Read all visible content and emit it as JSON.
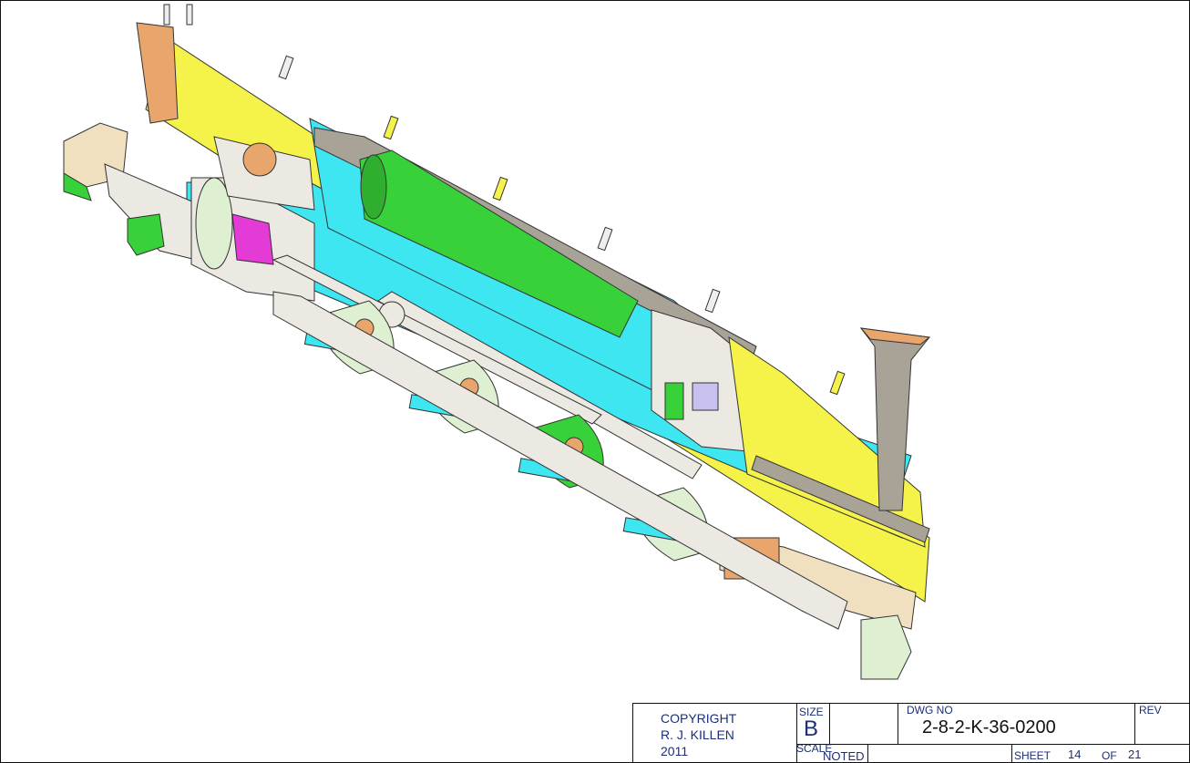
{
  "title_block": {
    "copyright": [
      "COPYRIGHT",
      "R. J. KILLEN",
      "2011"
    ],
    "size_label": "SIZE",
    "size_value": "B",
    "scale_label": "SCALE",
    "scale_value": "NOTED",
    "dwg_no_label": "DWG NO",
    "dwg_no": "2-8-2-K-36-0200",
    "rev_label": "REV",
    "sheet_label": "SHEET",
    "sheet_number": "14",
    "of_label": "OF",
    "sheet_total": "21"
  },
  "colors": {
    "yellow": "#f5f24a",
    "cyan": "#3ee6f2",
    "green": "#39d139",
    "light_green": "#dff0d2",
    "magenta": "#e43ad6",
    "copper": "#e8a66c",
    "gray": "#a9a397",
    "light_gray": "#ece8e2",
    "ink": "#1c2f75"
  }
}
